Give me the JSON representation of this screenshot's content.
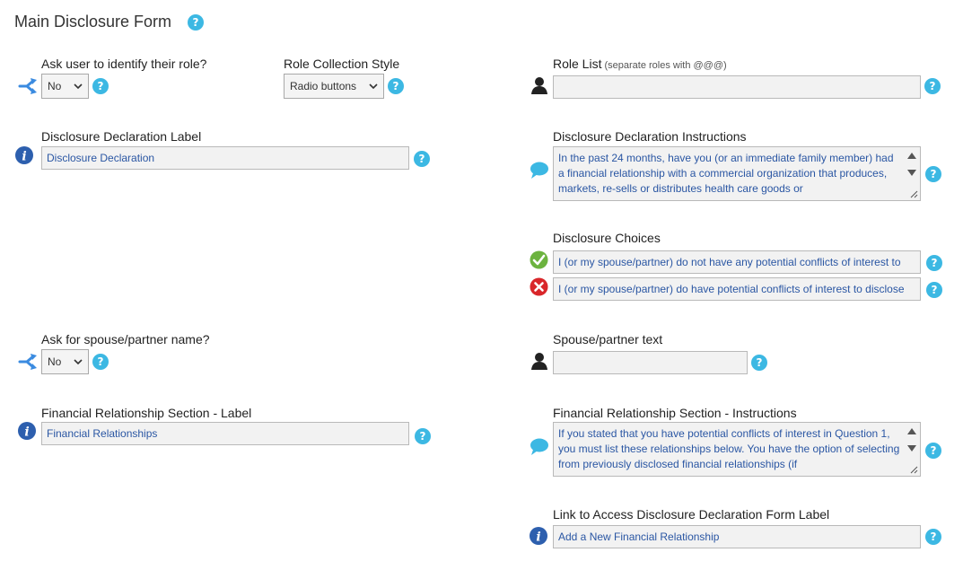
{
  "form": {
    "title": "Main Disclosure Form",
    "help_glyph": "?"
  },
  "identify_role": {
    "label": "Ask user to identify their role?",
    "value": "No",
    "icon": "branch-icon"
  },
  "role_collection": {
    "label": "Role Collection Style",
    "value": "Radio buttons"
  },
  "role_list": {
    "label": "Role List",
    "note": "(separate roles with @@@)",
    "value": "",
    "icon": "user-icon"
  },
  "declaration_label": {
    "label": "Disclosure Declaration Label",
    "value": "Disclosure Declaration",
    "icon": "info-icon"
  },
  "declaration_instructions": {
    "label": "Disclosure Declaration Instructions",
    "value": "In the past 24 months, have you (or an immediate family member) had a financial relationship with a commercial organization that produces, markets, re-sells or distributes health care goods or",
    "icon": "speech-bubble-icon"
  },
  "disclosure_choices": {
    "label": "Disclosure Choices",
    "no_conflict": "I (or my spouse/partner) do not have any potential conflicts of interest to",
    "has_conflict": "I (or my spouse/partner) do have potential conflicts of interest to disclose"
  },
  "spouse_name": {
    "label": "Ask for spouse/partner name?",
    "value": "No",
    "icon": "branch-icon"
  },
  "spouse_text": {
    "label": "Spouse/partner text",
    "value": "",
    "icon": "user-icon"
  },
  "financial_label": {
    "label": "Financial Relationship Section - Label",
    "value": "Financial Relationships",
    "icon": "info-icon"
  },
  "financial_instructions": {
    "label": "Financial Relationship Section - Instructions",
    "value": "If you stated that you have potential conflicts of interest in Question 1, you must list these relationships below. You have the option of selecting from previously disclosed financial relationships (if",
    "icon": "speech-bubble-icon"
  },
  "link_label": {
    "label": "Link to Access Disclosure Declaration Form Label",
    "value": "Add a New Financial Relationship",
    "icon": "info-icon"
  },
  "colors": {
    "help": "#3cb8e3",
    "field_text": "#2a56a3",
    "info_icon": "#2d5fae",
    "branch_icon": "#3b8be0",
    "check": "#6cb33f",
    "cross": "#d9262a"
  }
}
